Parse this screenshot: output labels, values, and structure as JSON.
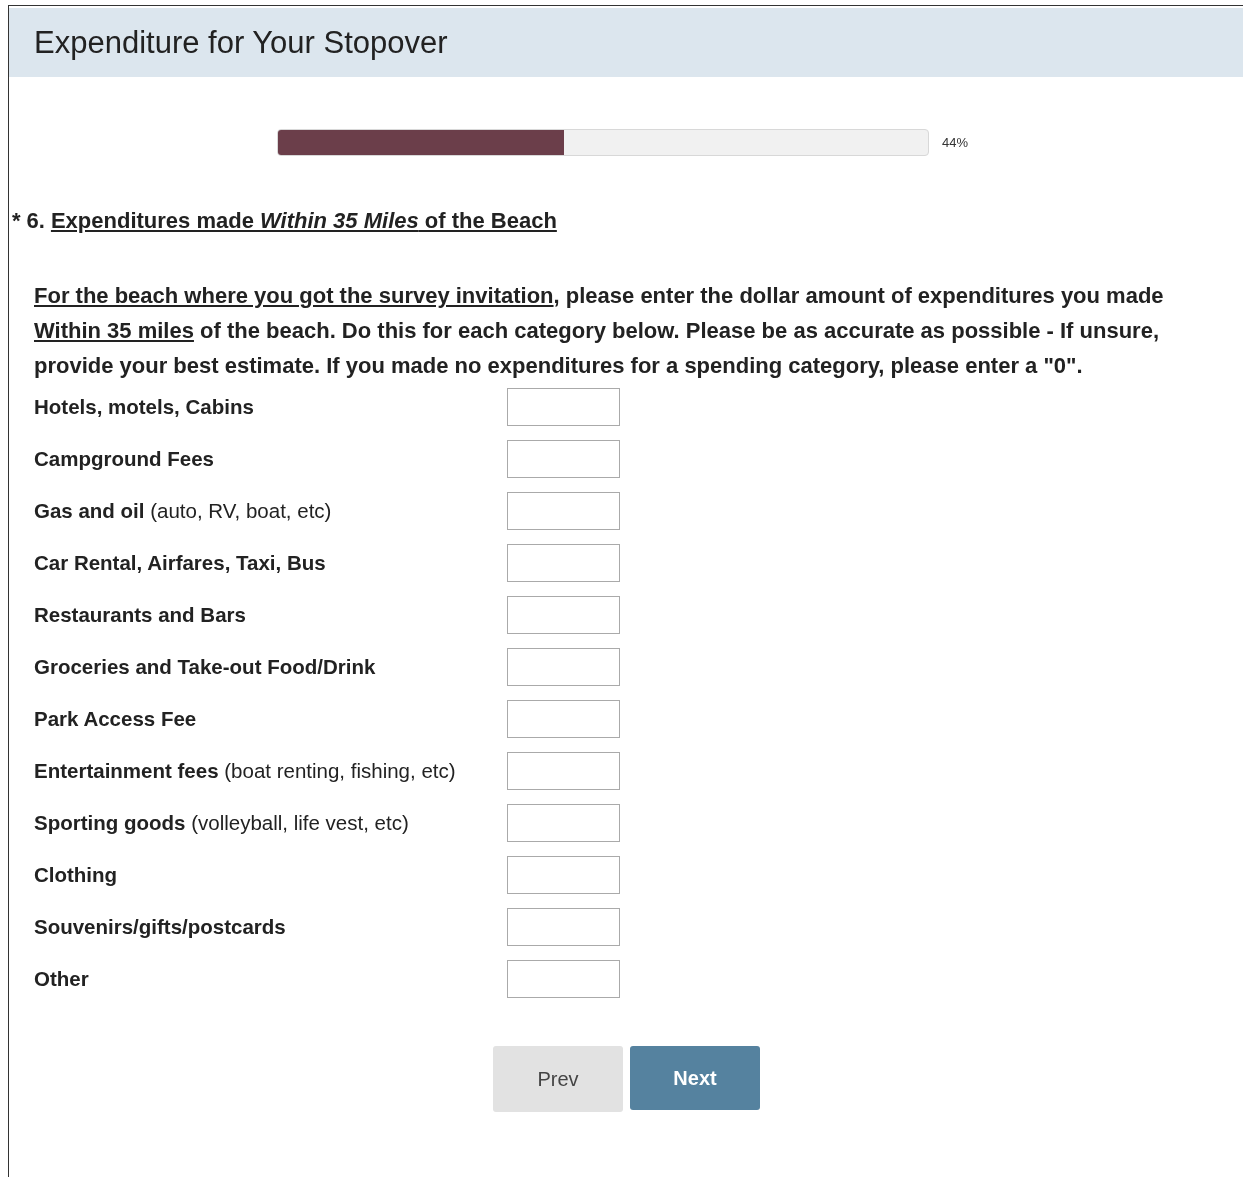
{
  "page": {
    "title": "Expenditure for Your Stopover"
  },
  "progress": {
    "level": 0.44,
    "reading": "44%"
  },
  "question": {
    "required_mark": "*",
    "number": "6.",
    "title": "Expenditures made *Within 35 Miles* of the Beach",
    "instructions": [
      {
        "text": "For the beach where you got the survey invitation",
        "underlined": true
      },
      {
        "text": ", please enter the dollar amount of expenditures you made ",
        "underlined": false
      },
      {
        "text": "Within 35 miles",
        "underlined": true
      },
      {
        "text": " of the beach. Do this for each category below. Please be as accurate as possible - If unsure, provide your best estimate. If you made no expenditures for a spending category, please enter a \"0\".",
        "underlined": false
      }
    ],
    "rows": [
      {
        "label": "Hotels, motels, Cabins"
      },
      {
        "label": "Campground Fees"
      },
      {
        "label": "Gas and oil",
        "note": "(auto, RV, boat, etc)"
      },
      {
        "label": "Car Rental, Airfares, Taxi, Bus"
      },
      {
        "label": "Restaurants and Bars"
      },
      {
        "label": "Groceries and Take-out Food/Drink"
      },
      {
        "label": "Park Access Fee"
      },
      {
        "label": "Entertainment fees",
        "note": "(boat renting, fishing, etc)"
      },
      {
        "label": "Sporting goods",
        "note": "(volleyball, life vest, etc)"
      },
      {
        "label": "Clothing"
      },
      {
        "label": "Souvenirs/gifts/postcards"
      },
      {
        "label": "Other"
      }
    ]
  },
  "buttons": [
    {
      "label": "Prev",
      "kind": "secondary"
    },
    {
      "label": "Next",
      "kind": "primary"
    }
  ]
}
